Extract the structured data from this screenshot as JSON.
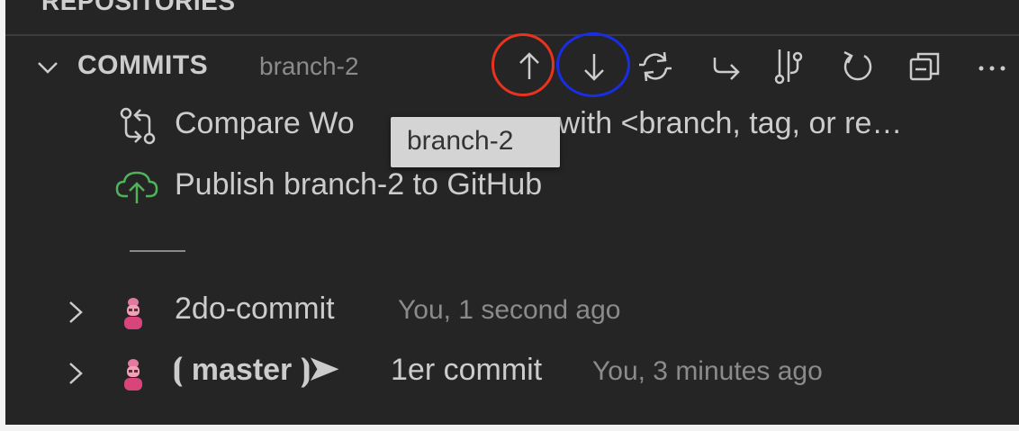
{
  "repositories": {
    "title": "REPOSITORIES"
  },
  "commits": {
    "title": "COMMITS",
    "branch": "branch-2",
    "toolbar": {
      "push_icon": "arrow-up-icon",
      "pull_icon": "arrow-down-icon",
      "sync_icon": "sync-icon",
      "checkout_icon": "arrow-return-icon",
      "compare_icon": "git-compare-icon",
      "refresh_icon": "refresh-icon",
      "collapse_icon": "collapse-all-icon",
      "more_icon": "more-icon"
    },
    "actions": [
      {
        "label": "Compare Working Tree with <branch, tag, or re…",
        "icon": "compare-changes-icon"
      },
      {
        "label": "Publish branch-2 to GitHub",
        "icon": "cloud-upload-icon"
      }
    ],
    "visible_actions": {
      "compare_prefix": "Compare Wo",
      "compare_suffix": "with <branch, tag, or re…"
    },
    "history": [
      {
        "message": "2do-commit",
        "meta": "You, 1 second ago"
      },
      {
        "message": "1er commit",
        "meta": "You, 3 minutes ago",
        "tag": "⦗ master ⦘➤"
      }
    ]
  },
  "tooltip": {
    "text": "branch-2"
  },
  "colors": {
    "background": "#252526",
    "text": "#cccccc",
    "muted": "#8b8b8b",
    "publish_icon": "#4fb35a",
    "push_highlight": "#e8331f",
    "pull_highlight": "#1a2de6"
  }
}
